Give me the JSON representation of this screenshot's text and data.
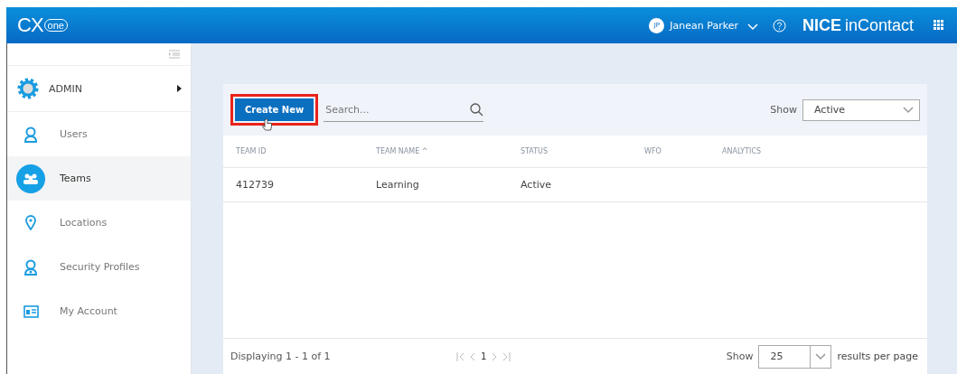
{
  "header": {
    "logo": "CX",
    "logo_sub": "one",
    "user": {
      "initials": "JP",
      "name": "Janean Parker"
    },
    "brand": "NICE",
    "brand_sub": "inContact"
  },
  "sidebar": {
    "section": {
      "label": "ADMIN",
      "expanded": false
    },
    "items": [
      {
        "label": "Users",
        "kind": "user",
        "selected": false
      },
      {
        "label": "Teams",
        "kind": "team",
        "selected": true
      },
      {
        "label": "Locations",
        "kind": "location",
        "selected": false
      },
      {
        "label": "Security Profiles",
        "kind": "profile",
        "selected": false
      },
      {
        "label": "My Account",
        "kind": "account",
        "selected": false
      }
    ]
  },
  "toolbar": {
    "create_button": "Create New",
    "highlighted": true,
    "search": {
      "placeholder": "Search..."
    },
    "show_label": "Show",
    "show_value": "Active"
  },
  "table": {
    "columns": [
      {
        "label": "TEAM ID"
      },
      {
        "label": "TEAM NAME",
        "sort_mark": "^"
      },
      {
        "label": "STATUS"
      },
      {
        "label": "WFO"
      },
      {
        "label": "ANALYTICS"
      }
    ],
    "rows": [
      [
        "412739",
        "Learning",
        "Active",
        "",
        ""
      ]
    ]
  },
  "footer": {
    "displaying": "Displaying 1 - 1 of 1",
    "page": "1",
    "show_label": "Show",
    "per_page": "25",
    "per_page_label": "results per page"
  }
}
